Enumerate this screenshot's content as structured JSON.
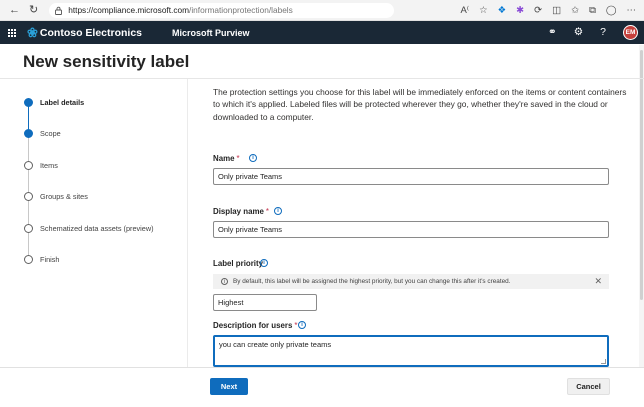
{
  "browser": {
    "url_host": "https://compliance.microsoft.com",
    "url_path": "/informationprotection/labels"
  },
  "suite_header": {
    "brand": "Contoso Electronics",
    "product": "Microsoft Purview",
    "avatar_initials": "EM"
  },
  "page": {
    "title": "New sensitivity label"
  },
  "wizard": {
    "steps": [
      {
        "label": "Label details",
        "state": "current"
      },
      {
        "label": "Scope",
        "state": "active"
      },
      {
        "label": "Items",
        "state": "pending"
      },
      {
        "label": "Groups & sites",
        "state": "pending"
      },
      {
        "label": "Schematized data assets (preview)",
        "state": "pending"
      },
      {
        "label": "Finish",
        "state": "pending"
      }
    ]
  },
  "form": {
    "intro": "The protection settings you choose for this label will be immediately enforced on the items or content containers to which it's applied. Labeled files will be protected wherever they go, whether they're saved in the cloud or downloaded to a computer.",
    "name": {
      "label": "Name",
      "required_mark": "*",
      "value": "Only private Teams"
    },
    "display_name": {
      "label": "Display name",
      "required_mark": "*",
      "value": "Only private Teams"
    },
    "label_priority": {
      "label": "Label priority",
      "info_banner": "By default, this label will be assigned the highest priority, but you can change this after it's created.",
      "value": "Highest"
    },
    "description": {
      "label": "Description for users",
      "required_mark": "*",
      "value": "you can create only private teams"
    }
  },
  "footer": {
    "next": "Next",
    "cancel": "Cancel"
  },
  "colors": {
    "accent": "#0f6cbd",
    "suite_bar": "#1a2836",
    "required": "#c4314b"
  },
  "icons": [
    "back-icon",
    "refresh-icon",
    "lock-icon",
    "read-aloud-icon",
    "favorite-icon",
    "extension-icon",
    "split-screen-icon",
    "favorites-icon",
    "collections-icon",
    "waffle-icon",
    "brand-logo-icon",
    "network-icon",
    "settings-icon",
    "help-icon",
    "info-icon",
    "close-icon"
  ]
}
